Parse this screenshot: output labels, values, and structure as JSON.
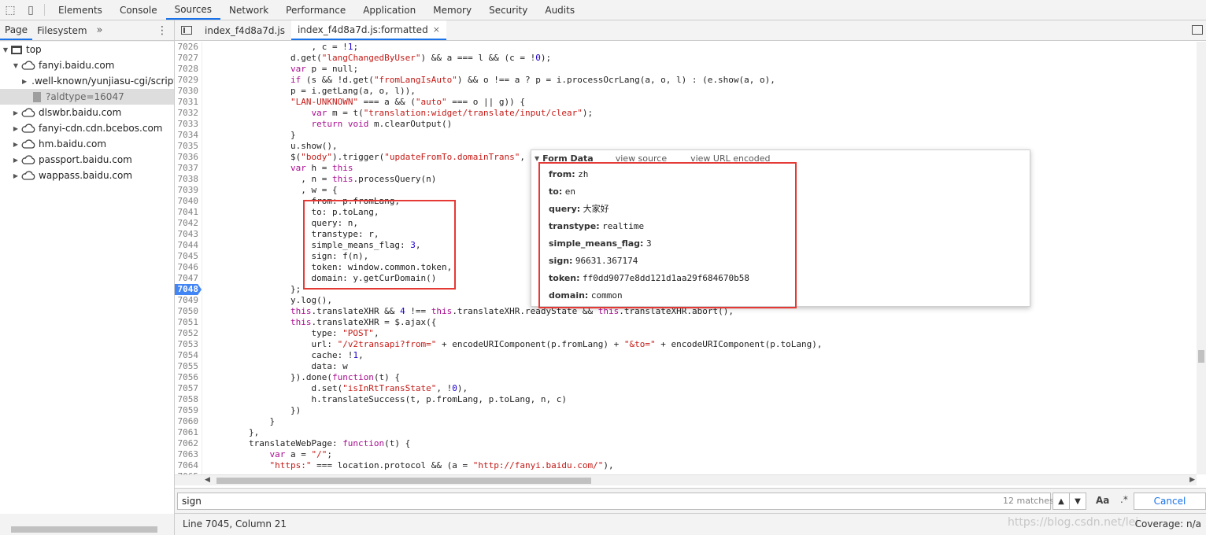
{
  "toolbar": {
    "tabs": [
      "Elements",
      "Console",
      "Sources",
      "Network",
      "Performance",
      "Application",
      "Memory",
      "Security",
      "Audits"
    ],
    "active": "Sources"
  },
  "sidebar": {
    "tabs": [
      "Page",
      "Filesystem"
    ],
    "more": "»",
    "tree": [
      {
        "label": "top",
        "icon": "frame-icon",
        "depth": 0,
        "expanded": true
      },
      {
        "label": "fanyi.baidu.com",
        "icon": "cloud-icon",
        "depth": 1,
        "expanded": true
      },
      {
        "label": ".well-known/yunjiasu-cgi/script",
        "icon": "folder-icon",
        "depth": 2,
        "expanded": false
      },
      {
        "label": "?aldtype=16047",
        "icon": "file-icon",
        "depth": 2,
        "selected": true
      },
      {
        "label": "dlswbr.baidu.com",
        "icon": "cloud-icon",
        "depth": 1,
        "expanded": false
      },
      {
        "label": "fanyi-cdn.cdn.bcebos.com",
        "icon": "cloud-icon",
        "depth": 1,
        "expanded": false
      },
      {
        "label": "hm.baidu.com",
        "icon": "cloud-icon",
        "depth": 1,
        "expanded": false
      },
      {
        "label": "passport.baidu.com",
        "icon": "cloud-icon",
        "depth": 1,
        "expanded": false
      },
      {
        "label": "wappass.baidu.com",
        "icon": "cloud-icon",
        "depth": 1,
        "expanded": false
      }
    ]
  },
  "filetabs": [
    {
      "label": "index_f4d8a7d.js",
      "active": false
    },
    {
      "label": "index_f4d8a7d.js:formatted",
      "active": true,
      "close": "×"
    }
  ],
  "code": {
    "breakpoint_line": "7048",
    "lines": [
      {
        "n": "7026",
        "t": "                    , c = !1;"
      },
      {
        "n": "7027",
        "t": "                d.get(\"langChangedByUser\") && a === l && (c = !0);"
      },
      {
        "n": "7028",
        "t": "                var p = null;"
      },
      {
        "n": "7029",
        "t": "                if (s && !d.get(\"fromLangIsAuto\") && o !== a ? p = i.processOcrLang(a, o, l) : (e.show(a, o),"
      },
      {
        "n": "7030",
        "t": "                p = i.getLang(a, o, l)),"
      },
      {
        "n": "7031",
        "t": "                \"LAN-UNKNOWN\" === a && (\"auto\" === o || g)) {"
      },
      {
        "n": "7032",
        "t": "                    var m = t(\"translation:widget/translate/input/clear\");"
      },
      {
        "n": "7033",
        "t": "                    return void m.clearOutput()"
      },
      {
        "n": "7034",
        "t": "                }"
      },
      {
        "n": "7035",
        "t": "                u.show(),"
      },
      {
        "n": "7036",
        "t": "                $(\"body\").trigger(\"updateFromTo.domainTrans\", {"
      },
      {
        "n": "7037",
        "t": "                var h = this"
      },
      {
        "n": "7038",
        "t": "                  , n = this.processQuery(n)"
      },
      {
        "n": "7039",
        "t": "                  , w = {"
      },
      {
        "n": "7040",
        "t": "                    from: p.fromLang,"
      },
      {
        "n": "7041",
        "t": "                    to: p.toLang,"
      },
      {
        "n": "7042",
        "t": "                    query: n,"
      },
      {
        "n": "7043",
        "t": "                    transtype: r,"
      },
      {
        "n": "7044",
        "t": "                    simple_means_flag: 3,"
      },
      {
        "n": "7045",
        "t": "                    sign: f(n),"
      },
      {
        "n": "7046",
        "t": "                    token: window.common.token,"
      },
      {
        "n": "7047",
        "t": "                    domain: y.getCurDomain()"
      },
      {
        "n": "7048",
        "t": "                };"
      },
      {
        "n": "7049",
        "t": "                y.log(),"
      },
      {
        "n": "7050",
        "t": "                this.translateXHR && 4 !== this.translateXHR.readyState && this.translateXHR.abort(),"
      },
      {
        "n": "7051",
        "t": "                this.translateXHR = $.ajax({"
      },
      {
        "n": "7052",
        "t": "                    type: \"POST\","
      },
      {
        "n": "7053",
        "t": "                    url: \"/v2transapi?from=\" + encodeURIComponent(p.fromLang) + \"&to=\" + encodeURIComponent(p.toLang),"
      },
      {
        "n": "7054",
        "t": "                    cache: !1,"
      },
      {
        "n": "7055",
        "t": "                    data: w"
      },
      {
        "n": "7056",
        "t": "                }).done(function(t) {"
      },
      {
        "n": "7057",
        "t": "                    d.set(\"isInRtTransState\", !0),"
      },
      {
        "n": "7058",
        "t": "                    h.translateSuccess(t, p.fromLang, p.toLang, n, c)"
      },
      {
        "n": "7059",
        "t": "                })"
      },
      {
        "n": "7060",
        "t": "            }"
      },
      {
        "n": "7061",
        "t": "        },"
      },
      {
        "n": "7062",
        "t": "        translateWebPage: function(t) {"
      },
      {
        "n": "7063",
        "t": "            var a = \"/\";"
      },
      {
        "n": "7064",
        "t": "            \"https:\" === location.protocol && (a = \"http://fanyi.baidu.com/\"),"
      },
      {
        "n": "7065",
        "t": "            "
      }
    ]
  },
  "popover": {
    "title": "Form Data",
    "links": [
      "view source",
      "view URL encoded"
    ],
    "rows": [
      {
        "k": "from:",
        "v": "zh"
      },
      {
        "k": "to:",
        "v": "en"
      },
      {
        "k": "query:",
        "v": "大家好"
      },
      {
        "k": "transtype:",
        "v": "realtime"
      },
      {
        "k": "simple_means_flag:",
        "v": "3"
      },
      {
        "k": "sign:",
        "v": "96631.367174"
      },
      {
        "k": "token:",
        "v": "ff0dd9077e8dd121d1aa29f684670b58"
      },
      {
        "k": "domain:",
        "v": "common"
      }
    ]
  },
  "search": {
    "value": "sign",
    "matches": "12 matches",
    "case_label": "Aa",
    "regex_label": ".*",
    "cancel": "Cancel"
  },
  "status": {
    "position": "Line 7045, Column 21",
    "coverage": "Coverage: n/a",
    "watermark": "https://blog.csdn.net/lei"
  }
}
